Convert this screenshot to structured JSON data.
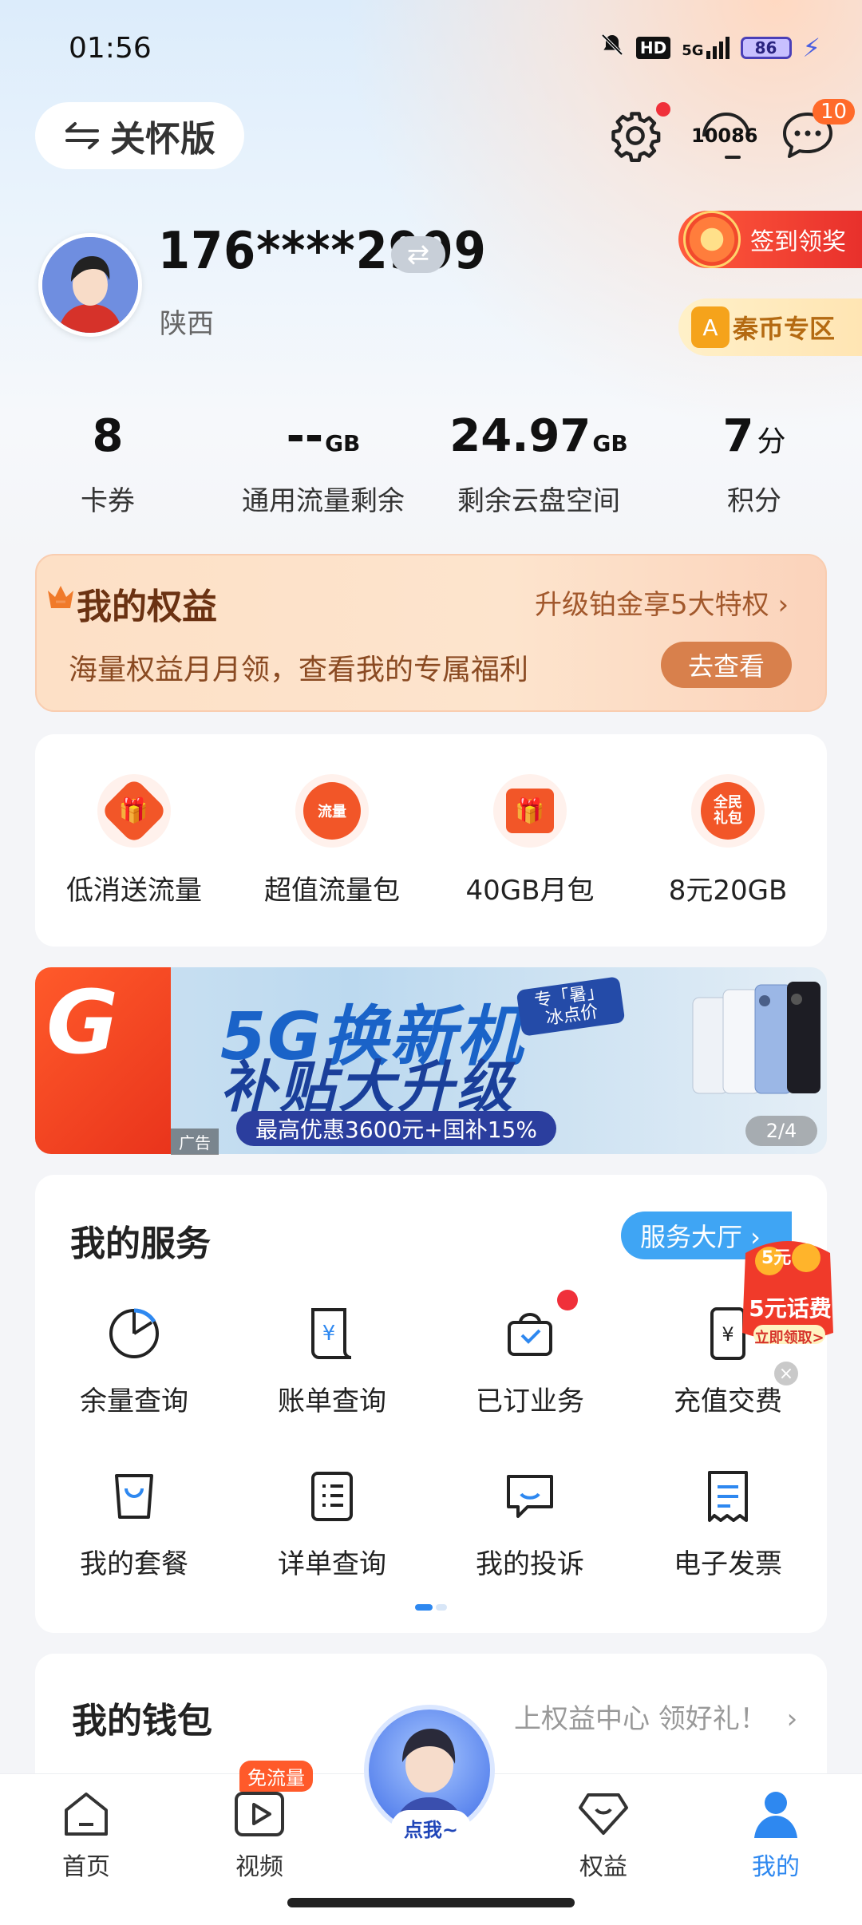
{
  "status_bar": {
    "time": "01:56",
    "network": "5G",
    "hd": "HD",
    "battery": "86"
  },
  "header": {
    "care_mode_label": "关怀版",
    "hotline_label": "10086",
    "message_badge": "10"
  },
  "profile": {
    "phone": "176****2999",
    "province": "陕西",
    "signin_label": "签到领奖",
    "coin_zone_label": "秦币专区",
    "coin_glyph": "A"
  },
  "stats": [
    {
      "value": "8",
      "unit": "",
      "label": "卡券"
    },
    {
      "value": "--",
      "unit": "GB",
      "label": "通用流量剩余"
    },
    {
      "value": "24.97",
      "unit": "GB",
      "label": "剩余云盘空间"
    },
    {
      "value": "7",
      "unit": "分",
      "label": "积分"
    }
  ],
  "benefits": {
    "title": "我的权益",
    "link": "升级铂金享5大特权 ›",
    "desc": "海量权益月月领，查看我的专属福利",
    "button": "去查看"
  },
  "quick_items": [
    {
      "label": "低消送流量",
      "icon_text": ""
    },
    {
      "label": "超值流量包",
      "icon_text": "流量"
    },
    {
      "label": "40GB月包",
      "icon_text": ""
    },
    {
      "label": "8元20GB",
      "icon_text": "全民礼包"
    }
  ],
  "banner": {
    "left_glyph": "G",
    "headline1": "5G换新机",
    "headline2": "补贴大升级",
    "subline": "最高优惠3600元+国补15%",
    "tag_line1": "专「暑」",
    "tag_line2": "冰点价",
    "ad_label": "广告",
    "page_indicator": "2/4"
  },
  "services": {
    "title": "我的服务",
    "hall_button": "服务大厅 ›",
    "items": [
      {
        "label": "余量查询"
      },
      {
        "label": "账单查询"
      },
      {
        "label": "已订业务"
      },
      {
        "label": "充值交费"
      },
      {
        "label": "我的套餐"
      },
      {
        "label": "详单查询"
      },
      {
        "label": "我的投诉"
      },
      {
        "label": "电子发票"
      }
    ],
    "promo": {
      "amount": "5元",
      "label": "5元话费",
      "cta": "立即领取>"
    }
  },
  "wallet": {
    "title": "我的钱包",
    "link": "上权益中心 领好礼！"
  },
  "bottom_nav": {
    "items": [
      {
        "label": "首页"
      },
      {
        "label": "视频"
      },
      {
        "label": "权益"
      },
      {
        "label": "我的"
      }
    ],
    "free_data_badge": "免流量",
    "assistant_label": "点我~"
  },
  "colors": {
    "accent": "#2e88f0",
    "brand_orange": "#f25628",
    "active_nav": "#2e88f0"
  }
}
